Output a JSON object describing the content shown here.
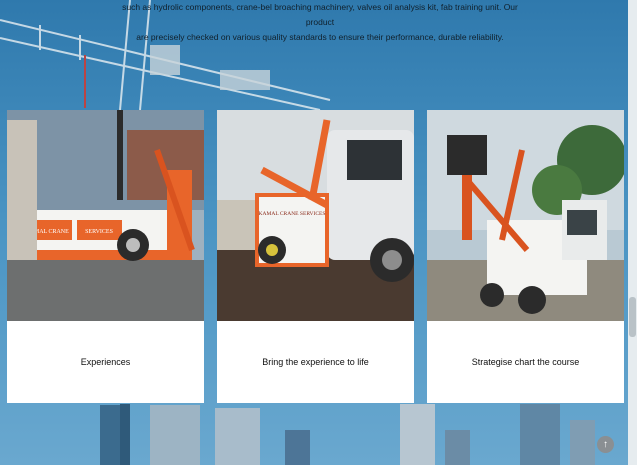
{
  "intro": {
    "line1": "such as hydrolic components, crane-bel broaching machinery, valves oil analysis kit, fab training unit. Our product",
    "line2": "are precisely checked on various quality standards to ensure their performance, durable reliability."
  },
  "cards": [
    {
      "caption": "Experiences",
      "truck_logo": "KAMAL CRANE",
      "truck_logo_2": "SERVICES"
    },
    {
      "caption": "Bring the experience to life",
      "truck_logo": "KAMAL CRANE SERVICES"
    },
    {
      "caption": "Strategise chart the course"
    }
  ],
  "scroll_top": {
    "icon": "arrow-up-icon",
    "glyph": "↑"
  },
  "colors": {
    "sky": "#3f86b8",
    "crane_orange": "#e8652a",
    "truck_white": "#f4f4f2"
  }
}
